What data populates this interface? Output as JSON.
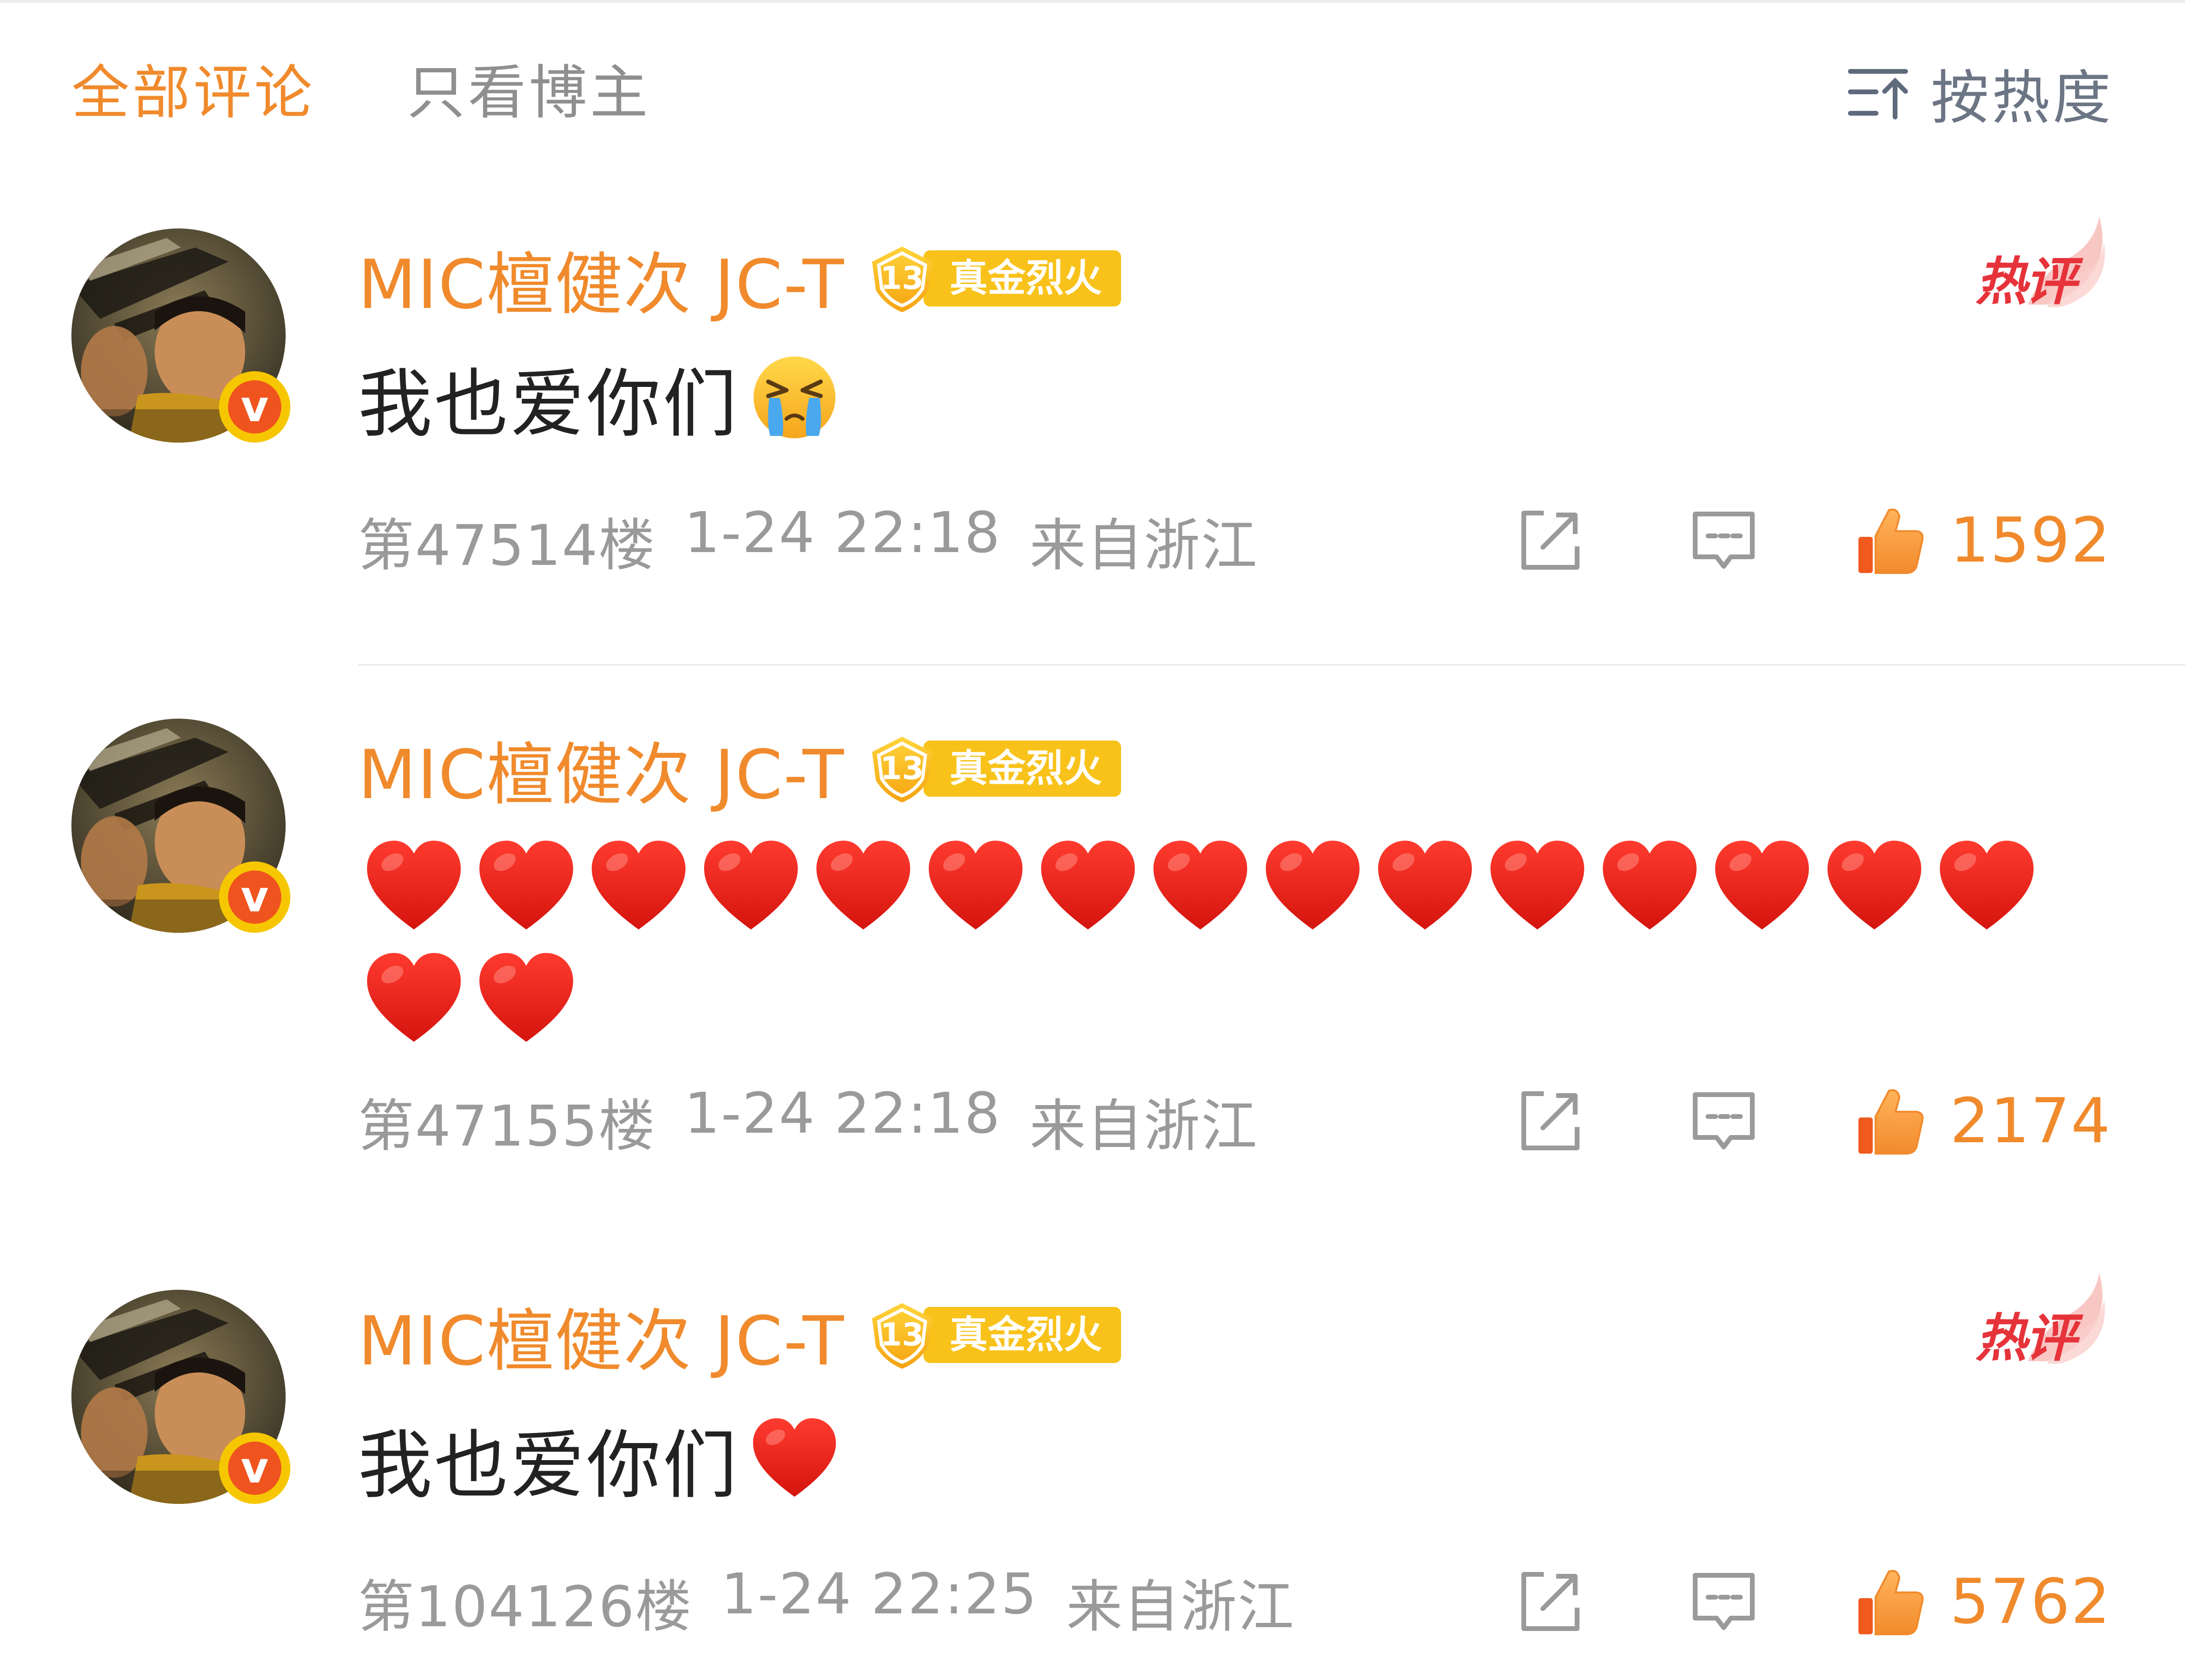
{
  "tabs": {
    "all": "全部评论",
    "blogger": "只看博主"
  },
  "sort": {
    "label": "按热度",
    "icon": "sort-icon"
  },
  "colors": {
    "accent": "#f08a2c",
    "hot": "#e6333a",
    "muted": "#9a9a9a",
    "medal": "#f8c21a"
  },
  "comments": [
    {
      "username": "MIC檀健次 JC-T",
      "medal": {
        "level": "13",
        "label": "真金烈火"
      },
      "hot_label": "热评",
      "text": "我也爱你们",
      "emoji": "crying-face-emoji",
      "floor": "第47514楼",
      "time": "1-24 22:18",
      "location": "来自浙江",
      "likes": "1592"
    },
    {
      "username": "MIC檀健次 JC-T",
      "medal": {
        "level": "13",
        "label": "真金烈火"
      },
      "hearts": 17,
      "emoji": "red-heart-emoji",
      "floor": "第47155楼",
      "time": "1-24 22:18",
      "location": "来自浙江",
      "likes": "2174"
    },
    {
      "username": "MIC檀健次 JC-T",
      "medal": {
        "level": "13",
        "label": "真金烈火"
      },
      "hot_label": "热评",
      "text": "我也爱你们",
      "emoji": "red-heart-emoji",
      "floor": "第104126楼",
      "time": "1-24 22:25",
      "location": "来自浙江",
      "likes": "5762"
    }
  ]
}
